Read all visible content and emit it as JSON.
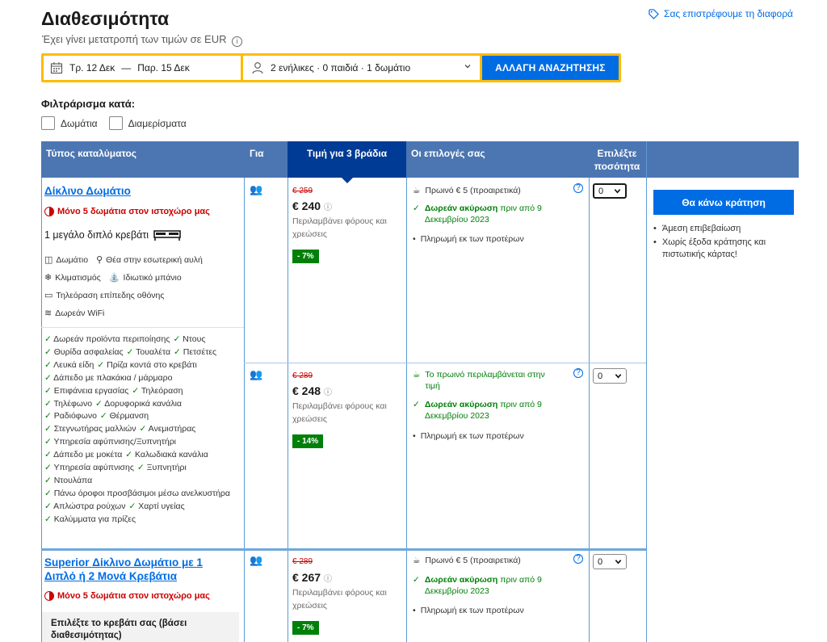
{
  "header": {
    "title": "Διαθεσιμότητα",
    "subtitle": "Έχει γίνει μετατροπή των τιμών σε EUR",
    "info_glyph": "i",
    "price_match": "Σας επιστρέφουμε τη διαφορά"
  },
  "search": {
    "dates": "Τρ. 12 Δεκ",
    "dates_sep": "—",
    "dates_end": "Παρ. 15 Δεκ",
    "guests": "2 ενήλικες · 0 παιδιά · 1 δωμάτιο",
    "button": "ΑΛΛΑΓΗ ΑΝΑΖΗΤΗΣΗΣ"
  },
  "filter": {
    "title": "Φιλτράρισμα κατά:",
    "options": [
      "Δωμάτια",
      "Διαμερίσματα"
    ]
  },
  "table": {
    "headers": {
      "type": "Τύπος καταλύματος",
      "for": "Για",
      "price": "Τιμή για 3 βράδια",
      "options": "Οι επιλογές σας",
      "qty": "Επιλέξτε ποσότητα"
    }
  },
  "rooms": [
    {
      "name": "Δίκλινο Δωμάτιο",
      "scarcity": "Μόνο 5 δωμάτια στον ιστοχώρο μας",
      "bed": "1 μεγάλο διπλό κρεβάτι",
      "features": [
        [
          "Δωμάτιο",
          "Θέα στην εσωτερική αυλή"
        ],
        [
          "Κλιματισμός",
          "Ιδιωτικό μπάνιο"
        ],
        [
          "Τηλεόραση επίπεδης οθόνης"
        ],
        [
          "Δωρεάν WiFi"
        ]
      ],
      "amenities": [
        [
          "Δωρεάν προϊόντα περιποίησης",
          "Ντους"
        ],
        [
          "Θυρίδα ασφαλείας",
          "Τουαλέτα",
          "Πετσέτες"
        ],
        [
          "Λευκά είδη",
          "Πρίζα κοντά στο κρεβάτι"
        ],
        [
          "Δάπεδο με πλακάκια / μάρμαρο"
        ],
        [
          "Επιφάνεια εργασίας",
          "Τηλεόραση"
        ],
        [
          "Τηλέφωνο",
          "Δορυφορικά κανάλια"
        ],
        [
          "Ραδιόφωνο",
          "Θέρμανση"
        ],
        [
          "Στεγνωτήρας μαλλιών",
          "Ανεμιστήρας"
        ],
        [
          "Υπηρεσία αφύπνισης/Ξυπνητήρι"
        ],
        [
          "Δάπεδο με μοκέτα",
          "Καλωδιακά κανάλια"
        ],
        [
          "Υπηρεσία αφύπνισης",
          "Ξυπνητήρι"
        ],
        [
          "Ντουλάπα"
        ],
        [
          "Πάνω όροφοι προσβάσιμοι μέσω ανελκυστήρα"
        ],
        [
          "Απλώστρα ρούχων",
          "Χαρτί υγείας"
        ],
        [
          "Καλύμματα για πρίζες"
        ]
      ],
      "offers": [
        {
          "old_price": "€ 259",
          "price": "€ 240",
          "tax": "Περιλαμβάνει φόρους και χρεώσεις",
          "discount": "- 7%",
          "breakfast": "Πρωινό € 5 (προαιρετικά)",
          "cancel_bold": "Δωρεάν ακύρωση",
          "cancel_rest": "πριν από 9",
          "cancel_date": "Δεκεμβρίου 2023",
          "prepay": "Πληρωμή εκ των προτέρων",
          "qty": "0"
        },
        {
          "old_price": "€ 289",
          "price": "€ 248",
          "tax": "Περιλαμβάνει φόρους και χρεώσεις",
          "discount": "- 14%",
          "breakfast": "Το πρωινό περιλαμβάνεται στην",
          "breakfast_2": "τιμή",
          "cancel_bold": "Δωρεάν ακύρωση",
          "cancel_rest": "πριν από 9",
          "cancel_date": "Δεκεμβρίου 2023",
          "prepay": "Πληρωμή εκ των προτέρων",
          "qty": "0"
        }
      ]
    },
    {
      "name_line1": "Superior Δίκλινο Δωμάτιο με 1",
      "name_line2": "Διπλό ή 2 Μονά Κρεβάτια",
      "scarcity": "Μόνο 5 δωμάτια στον ιστοχώρο μας",
      "bed_choice_line1": "Επιλέξτε το κρεβάτι σας (βάσει",
      "bed_choice_line2": "διαθεσιμότητας)",
      "offers": [
        {
          "old_price": "€ 289",
          "price": "€ 267",
          "tax": "Περιλαμβάνει φόρους και χρεώσεις",
          "discount": "- 7%",
          "breakfast": "Πρωινό € 5 (προαιρετικά)",
          "cancel_bold": "Δωρεάν ακύρωση",
          "cancel_rest": "πριν από 9",
          "cancel_date": "Δεκεμβρίου 2023",
          "prepay": "Πληρωμή εκ των προτέρων",
          "qty": "0"
        }
      ]
    }
  ],
  "booking": {
    "button": "Θα κάνω κράτηση",
    "bullets": [
      "Άμεση επιβεβαίωση",
      "Χωρίς έξοδα κράτησης και",
      "πιστωτικής κάρτας!"
    ]
  },
  "colors": {
    "accent": "#006ce4",
    "header_blue": "#4c76b2",
    "header_active": "#003b95",
    "search_border": "#febb02",
    "green": "#008009",
    "red": "#cc0000"
  }
}
